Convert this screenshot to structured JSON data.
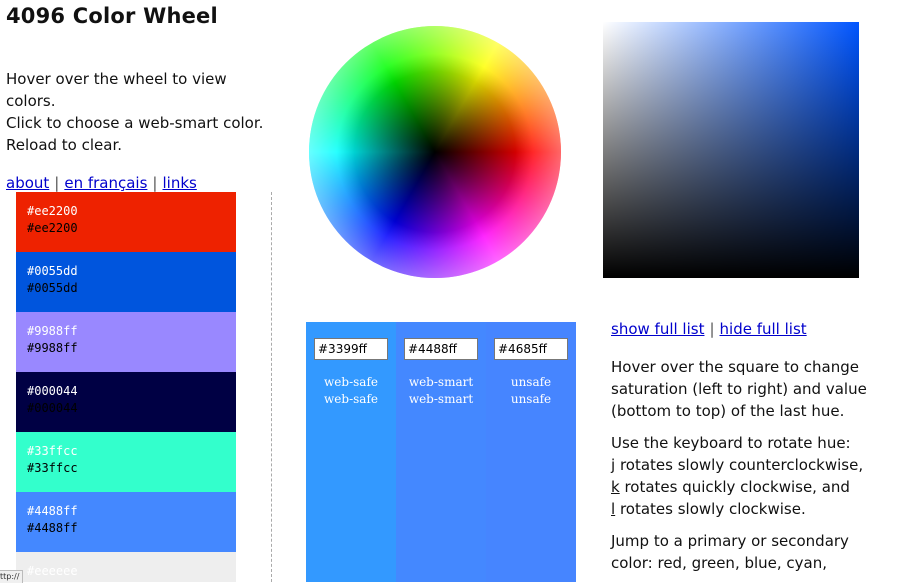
{
  "title": "4096 Color Wheel",
  "intro": {
    "line1": "Hover over the wheel to view",
    "line2": "colors.",
    "line3": "Click to choose a web-smart color.",
    "line4": "Reload to clear."
  },
  "nav": {
    "about": "about",
    "sep": "|",
    "french": "en français",
    "links": "links"
  },
  "swatches": [
    {
      "bg": "#ee2200",
      "label1": "#ee2200",
      "label2": "#ee2200",
      "c1": "#ffffff",
      "c2": "#000000"
    },
    {
      "bg": "#0055dd",
      "label1": "#0055dd",
      "label2": "#0055dd",
      "c1": "#ffffff",
      "c2": "#000000"
    },
    {
      "bg": "#9988ff",
      "label1": "#9988ff",
      "label2": "#9988ff",
      "c1": "#ffffff",
      "c2": "#000000"
    },
    {
      "bg": "#000044",
      "label1": "#000044",
      "label2": "#000044",
      "c1": "#ffffff",
      "c2": "#000000"
    },
    {
      "bg": "#33ffcc",
      "label1": "#33ffcc",
      "label2": "#33ffcc",
      "c1": "#ffffff",
      "c2": "#000000"
    },
    {
      "bg": "#4488ff",
      "label1": "#4488ff",
      "label2": "#4488ff",
      "c1": "#ffffff",
      "c2": "#000000"
    },
    {
      "bg": "#eeeeee",
      "label1": "#eeeeee",
      "label2": "",
      "c1": "#ffffff",
      "c2": "#000000"
    }
  ],
  "wheel": {
    "cursor_hue_hex": "#0055ff"
  },
  "panel": {
    "columns": [
      {
        "bg": "#3399ff",
        "value": "#3399ff",
        "label1": "web-safe",
        "label2": "web-safe"
      },
      {
        "bg": "#4488ff",
        "value": "#4488ff",
        "label1": "web-smart",
        "label2": "web-smart"
      },
      {
        "bg": "#4685ff",
        "value": "#4685ff",
        "label1": "unsafe",
        "label2": "unsafe"
      }
    ]
  },
  "list_links": {
    "show": "show full list",
    "sep": "|",
    "hide": "hide full list"
  },
  "help": {
    "p1": [
      "Hover over the square to change",
      "saturation (left to right) and value",
      "(bottom to top) of the last hue."
    ],
    "p2_line1": "Use the keyboard to rotate hue:",
    "keys": [
      {
        "key": "j",
        "text": " rotates slowly counterclockwise,"
      },
      {
        "key": "k",
        "text": " rotates quickly clockwise, and"
      },
      {
        "key": "l",
        "text": " rotates slowly clockwise."
      }
    ],
    "p3": [
      "Jump to a primary or secondary",
      "color: red, green, blue, cyan,"
    ]
  },
  "status": "ttp://"
}
